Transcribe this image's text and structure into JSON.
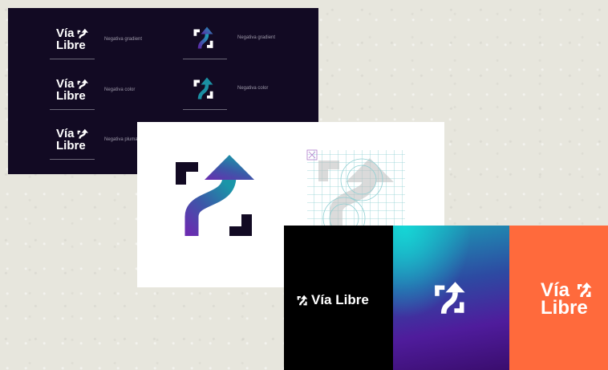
{
  "brand": {
    "name_line1": "Vía",
    "name_line2": "Libre",
    "name_inline": "Vía Libre"
  },
  "variations": [
    {
      "caption": "Negativa gradient"
    },
    {
      "caption": "Negativa gradient"
    },
    {
      "caption": "Negativa color"
    },
    {
      "caption": "Negativa color"
    },
    {
      "caption": "Negativa pluma"
    }
  ],
  "colors": {
    "dark_bg": "#120a23",
    "teal": "#1b8fa3",
    "purple": "#5a2aa6",
    "orange": "#ff6a3c",
    "black": "#000000",
    "grid_line": "#8ecfd2"
  },
  "icons": [
    "via-libre-arrow-icon"
  ]
}
